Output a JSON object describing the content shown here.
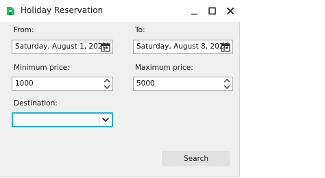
{
  "window": {
    "title": "Holiday Reservation"
  },
  "form": {
    "from_label": "From:",
    "from_value": "Saturday, August 1, 2020",
    "to_label": "To:",
    "to_value": "Saturday, August 8, 2020",
    "min_price_label": "Minimum price:",
    "min_price_value": "1000",
    "max_price_label": "Maximum price:",
    "max_price_value": "5000",
    "destination_label": "Destination:",
    "destination_value": "",
    "search_label": "Search"
  },
  "colors": {
    "accent": "#1fb0d0",
    "brand_green": "#2bbd5a"
  },
  "icons": [
    "app-logo-icon",
    "minimize-icon",
    "maximize-icon",
    "close-icon",
    "calendar-icon",
    "chevron-up-icon",
    "chevron-down-icon"
  ]
}
